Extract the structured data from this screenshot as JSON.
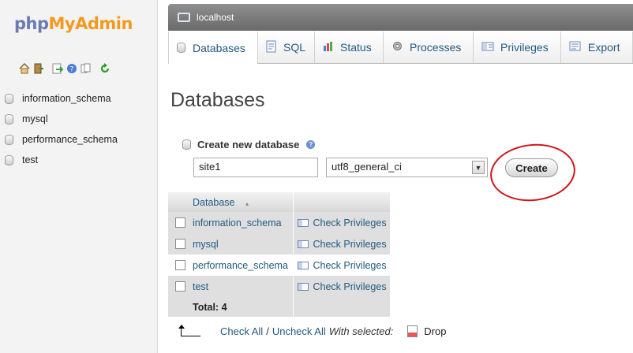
{
  "nav": {
    "logo_left": "php",
    "logo_right": "MyAdmin",
    "icons": [
      "home-icon",
      "exit-icon",
      "query-window-icon",
      "documentation-icon",
      "docs-icon",
      "reload-icon"
    ],
    "databases": [
      {
        "name": "information_schema"
      },
      {
        "name": "mysql"
      },
      {
        "name": "performance_schema"
      },
      {
        "name": "test"
      }
    ]
  },
  "header": {
    "server": "localhost"
  },
  "tabs": [
    {
      "label": "Databases",
      "icon": "database-icon",
      "active": true
    },
    {
      "label": "SQL",
      "icon": "sql-icon"
    },
    {
      "label": "Status",
      "icon": "status-icon"
    },
    {
      "label": "Processes",
      "icon": "processes-icon"
    },
    {
      "label": "Privileges",
      "icon": "privileges-icon"
    },
    {
      "label": "Export",
      "icon": "export-icon"
    }
  ],
  "page_title": "Databases",
  "create": {
    "heading": "Create new database",
    "name_value": "site1",
    "collation_value": "utf8_general_ci",
    "button_label": "Create",
    "highlight_color": "#ffff1a",
    "annotation_color": "#d0141c"
  },
  "table": {
    "header_database": "Database",
    "sort_indicator": "▴",
    "rows": [
      {
        "name": "information_schema",
        "action": "Check Privileges"
      },
      {
        "name": "mysql",
        "action": "Check Privileges"
      },
      {
        "name": "performance_schema",
        "action": "Check Privileges"
      },
      {
        "name": "test",
        "action": "Check Privileges"
      }
    ],
    "total": "Total: 4"
  },
  "bottom": {
    "check_all": "Check All",
    "separator": "/",
    "uncheck_all": "Uncheck All",
    "with_selected": "With selected:",
    "drop": "Drop"
  }
}
